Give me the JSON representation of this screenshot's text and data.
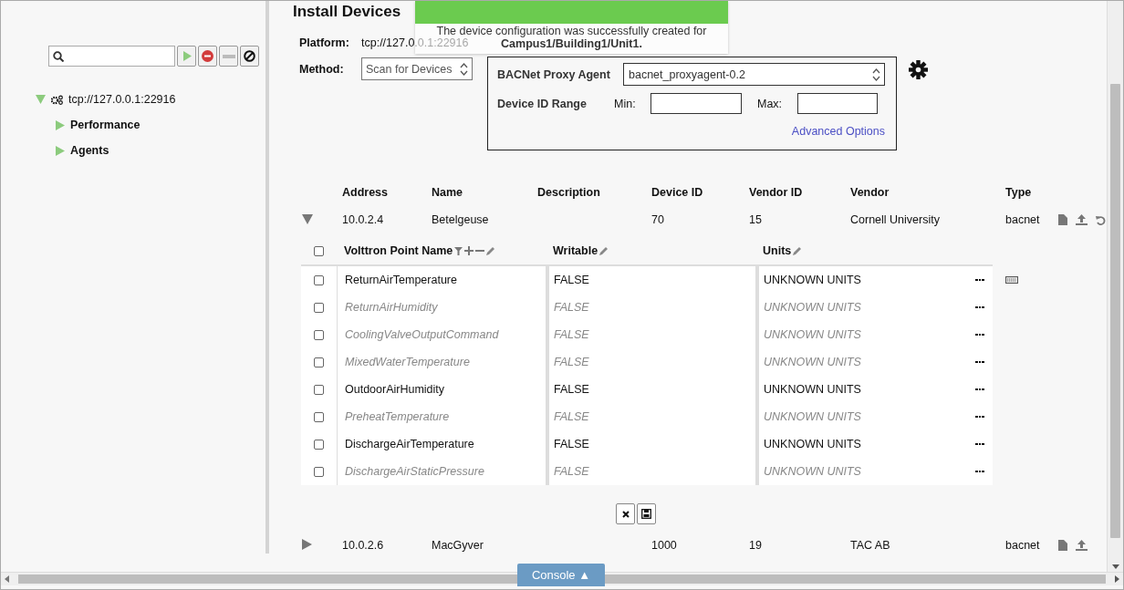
{
  "page_title": "Install Devices",
  "sidebar": {
    "tool_buttons": [
      {
        "kind": "play"
      },
      {
        "kind": "stop"
      },
      {
        "kind": "minus"
      },
      {
        "kind": "ban"
      }
    ],
    "tree": [
      {
        "label": "tcp://127.0.0.1:22916",
        "expanded": true,
        "children": [
          {
            "label": "Performance",
            "expanded": false
          },
          {
            "label": "Agents",
            "expanded": false
          }
        ]
      }
    ]
  },
  "platform": {
    "label": "Platform:",
    "value": "tcp://127.0.0.1:22916"
  },
  "method": {
    "label": "Method:",
    "value": "Scan for Devices"
  },
  "scan_options": {
    "proxy_label": "BACNet Proxy Agent",
    "proxy_value": "bacnet_proxyagent-0.2",
    "range_label": "Device ID Range",
    "min_label": "Min:",
    "max_label": "Max:",
    "advanced_link": "Advanced Options"
  },
  "notification": {
    "message": "The device configuration was successfully created for",
    "detail": "Campus1/Building1/Unit1."
  },
  "devices": {
    "columns": [
      "Address",
      "Name",
      "Description",
      "Device ID",
      "Vendor ID",
      "Vendor",
      "Type"
    ],
    "rows": [
      {
        "expanded": true,
        "cells": [
          "10.0.2.4",
          "Betelgeuse",
          "",
          "70",
          "15",
          "Cornell University",
          "bacnet"
        ],
        "actions": [
          {
            "kind": "file"
          },
          {
            "kind": "upload"
          },
          {
            "kind": "undo"
          }
        ],
        "points": {
          "columns": [
            "Volttron Point Name",
            "Writable",
            "Units"
          ],
          "all_checked": false,
          "rows": [
            {
              "name": "ReturnAirTemperature",
              "writable": "FALSE",
              "units": "UNKNOWN UNITS",
              "checked": false,
              "disabled": false,
              "keyboard": true
            },
            {
              "name": "ReturnAirHumidity",
              "writable": "FALSE",
              "units": "UNKNOWN UNITS",
              "checked": false,
              "disabled": true,
              "keyboard": false
            },
            {
              "name": "CoolingValveOutputCommand",
              "writable": "FALSE",
              "units": "UNKNOWN UNITS",
              "checked": false,
              "disabled": true,
              "keyboard": false
            },
            {
              "name": "MixedWaterTemperature",
              "writable": "FALSE",
              "units": "UNKNOWN UNITS",
              "checked": false,
              "disabled": true,
              "keyboard": false
            },
            {
              "name": "OutdoorAirHumidity",
              "writable": "FALSE",
              "units": "UNKNOWN UNITS",
              "checked": false,
              "disabled": false,
              "keyboard": false
            },
            {
              "name": "PreheatTemperature",
              "writable": "FALSE",
              "units": "UNKNOWN UNITS",
              "checked": false,
              "disabled": true,
              "keyboard": false
            },
            {
              "name": "DischargeAirTemperature",
              "writable": "FALSE",
              "units": "UNKNOWN UNITS",
              "checked": false,
              "disabled": false,
              "keyboard": false
            },
            {
              "name": "DischargeAirStaticPressure",
              "writable": "FALSE",
              "units": "UNKNOWN UNITS",
              "checked": false,
              "disabled": true,
              "keyboard": false
            }
          ]
        }
      },
      {
        "expanded": false,
        "cells": [
          "10.0.2.6",
          "MacGyver",
          "",
          "1000",
          "19",
          "TAC AB",
          "bacnet"
        ],
        "actions": [
          {
            "kind": "file"
          },
          {
            "kind": "upload"
          }
        ]
      }
    ]
  },
  "console_tab": "Console ▲"
}
